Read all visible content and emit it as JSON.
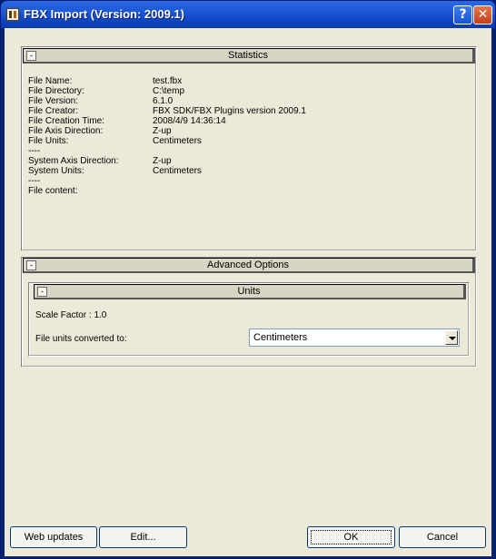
{
  "window": {
    "title": "FBX Import (Version: 2009.1)",
    "help_label": "?",
    "close_label": "✕"
  },
  "statistics": {
    "header": "Statistics",
    "collapse_label": "-",
    "rows": [
      {
        "label": "File Name:",
        "value": "test.fbx"
      },
      {
        "label": "File Directory:",
        "value": "C:\\temp"
      },
      {
        "label": "File Version:",
        "value": "6.1.0"
      },
      {
        "label": "File Creator:",
        "value": "FBX SDK/FBX Plugins version 2009.1"
      },
      {
        "label": "File Creation Time:",
        "value": "2008/4/9  14:36:14"
      },
      {
        "label": "File Axis Direction:",
        "value": "Z-up"
      },
      {
        "label": "File Units:",
        "value": "Centimeters"
      },
      {
        "label": "----",
        "value": ""
      },
      {
        "label": "System Axis Direction:",
        "value": "Z-up"
      },
      {
        "label": "System Units:",
        "value": "Centimeters"
      },
      {
        "label": "----",
        "value": ""
      },
      {
        "label": "File content:",
        "value": ""
      }
    ]
  },
  "advanced": {
    "header": "Advanced Options",
    "collapse_label": "-",
    "units": {
      "header": "Units",
      "collapse_label": "-",
      "scale_factor": "Scale Factor : 1.0",
      "converted_label": "File units converted to:",
      "converted_value": "Centimeters"
    }
  },
  "buttons": {
    "web_updates": "Web updates",
    "edit": "Edit...",
    "ok": "OK",
    "cancel": "Cancel"
  }
}
